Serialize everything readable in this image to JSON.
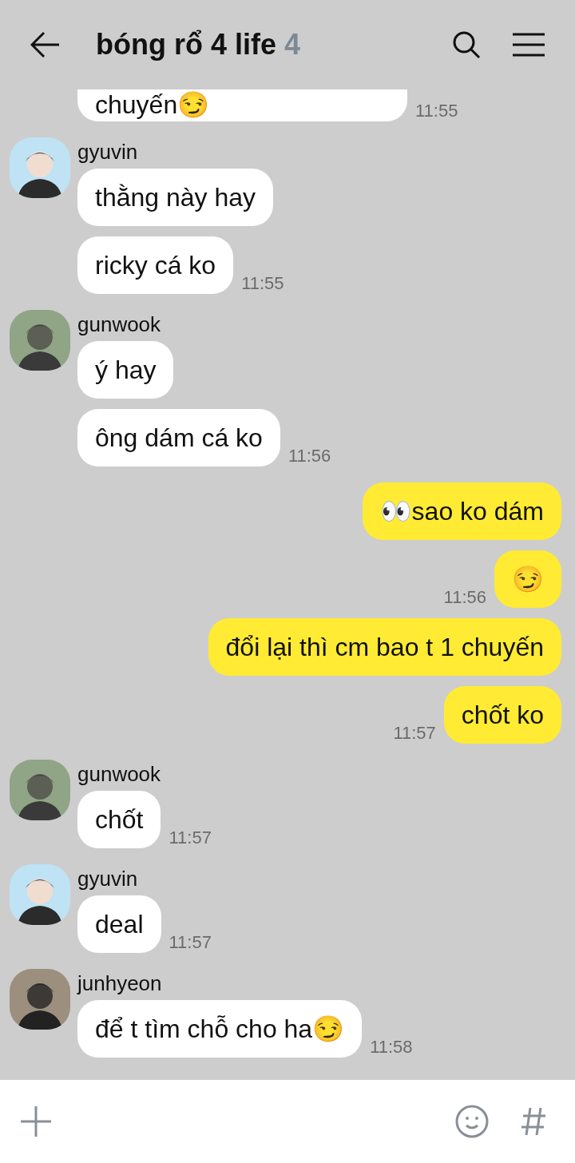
{
  "header": {
    "title": "bóng rổ 4 life",
    "member_count": "4"
  },
  "groups": [
    {
      "kind": "received",
      "partial": true,
      "messages": [
        {
          "text": "chuyến😏",
          "time": "11:55"
        }
      ]
    },
    {
      "kind": "received",
      "sender": "gyuvin",
      "messages": [
        {
          "text": "thằng này hay"
        },
        {
          "text": "ricky cá ko",
          "time": "11:55"
        }
      ]
    },
    {
      "kind": "received",
      "sender": "gunwook",
      "messages": [
        {
          "text": "ý hay"
        },
        {
          "text": "ông dám cá ko",
          "time": "11:56"
        }
      ]
    },
    {
      "kind": "sent",
      "messages": [
        {
          "text": "👀sao ko dám"
        },
        {
          "text": "😏",
          "time": "11:56"
        },
        {
          "text": "đổi lại thì cm bao t 1 chuyến"
        },
        {
          "text": "chốt ko",
          "time": "11:57"
        }
      ]
    },
    {
      "kind": "received",
      "sender": "gunwook",
      "messages": [
        {
          "text": "chốt",
          "time": "11:57"
        }
      ]
    },
    {
      "kind": "received",
      "sender": "gyuvin",
      "messages": [
        {
          "text": "deal",
          "time": "11:57"
        }
      ]
    },
    {
      "kind": "received",
      "sender": "junhyeon",
      "messages": [
        {
          "text": "để t tìm chỗ cho ha😏",
          "time": "11:58"
        }
      ]
    }
  ]
}
